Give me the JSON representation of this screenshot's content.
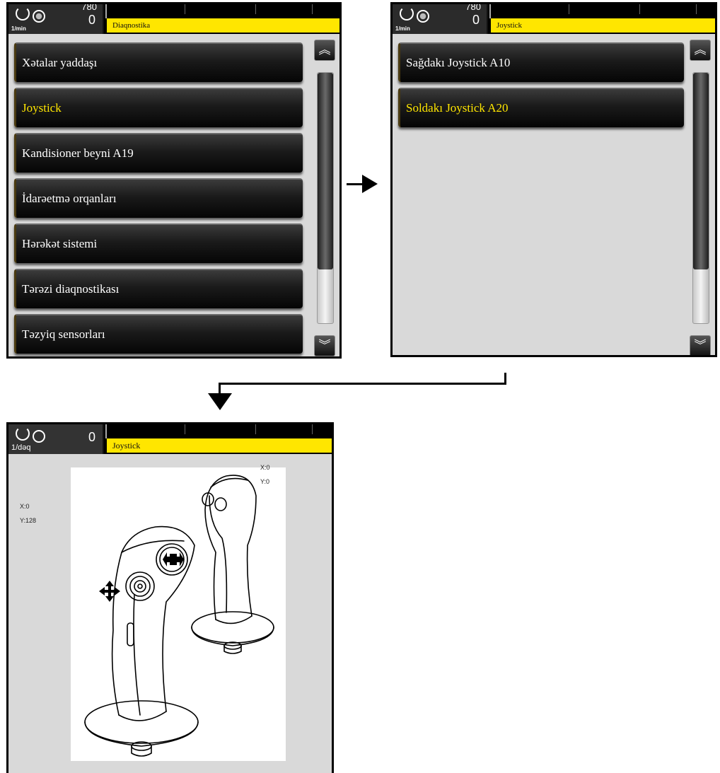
{
  "screen1": {
    "gauge": {
      "unit": "1/min",
      "value_top": "780",
      "value": "0"
    },
    "title": "Diaqnostika",
    "items": [
      {
        "label": "Xətalar yaddaşı",
        "selected": false
      },
      {
        "label": "Joystick",
        "selected": true
      },
      {
        "label": "Kandisioner beyni A19",
        "selected": false
      },
      {
        "label": "İdarəetmə orqanları",
        "selected": false
      },
      {
        "label": "Hərəkət sistemi",
        "selected": false
      },
      {
        "label": "Tərəzi diaqnostikası",
        "selected": false
      },
      {
        "label": "Təzyiq sensorları",
        "selected": false
      }
    ],
    "scroll_up": "︽",
    "scroll_down": "︾"
  },
  "screen2": {
    "gauge": {
      "unit": "1/min",
      "value_top": "780",
      "value": "0"
    },
    "title": "Joystick",
    "items": [
      {
        "label": "Sağdakı Joystick A10",
        "selected": false
      },
      {
        "label": "Soldakı Joystick A20",
        "selected": true
      }
    ],
    "scroll_up": "︽",
    "scroll_down": "︾"
  },
  "screen3": {
    "gauge": {
      "unit": "1/dəq",
      "value": "0"
    },
    "title": "Joystick",
    "left_joystick": {
      "x": "X:0",
      "y": "Y:128"
    },
    "right_joystick": {
      "x": "X:0",
      "y": "Y:0"
    }
  },
  "colors": {
    "title_bar": "#ffe600",
    "selected_text": "#ffe600",
    "screen_bg": "#d9d9d9"
  }
}
